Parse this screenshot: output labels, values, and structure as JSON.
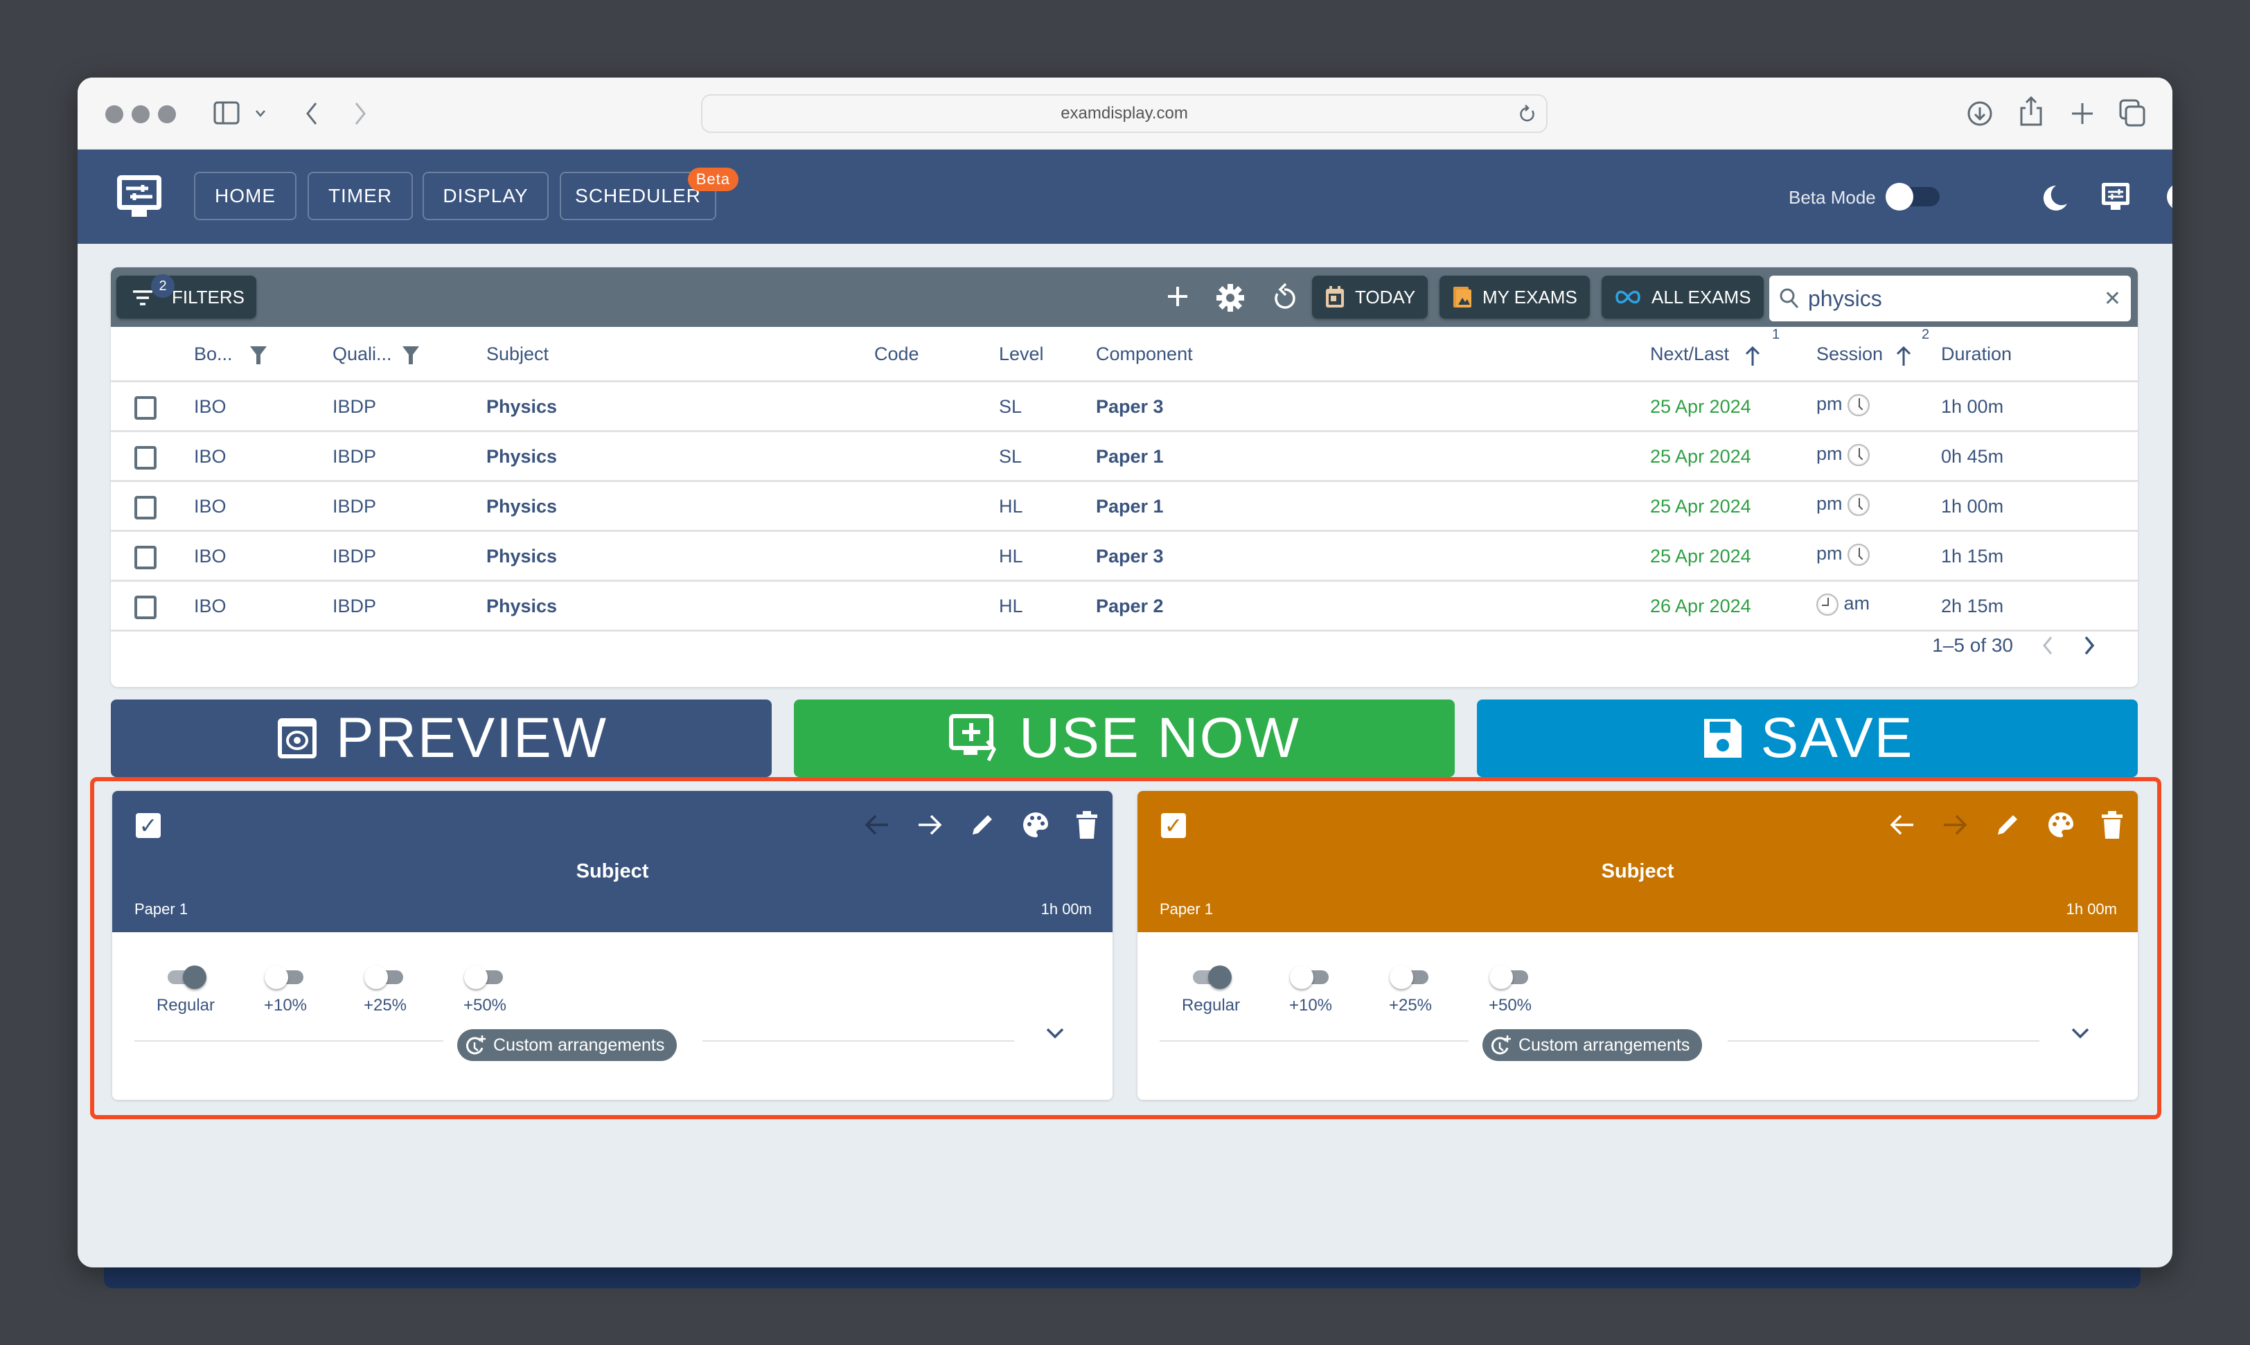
{
  "browser": {
    "url": "examdisplay.com"
  },
  "appbar": {
    "nav": [
      {
        "label": "HOME"
      },
      {
        "label": "TIMER"
      },
      {
        "label": "DISPLAY"
      },
      {
        "label": "SCHEDULER",
        "badge": "Beta"
      }
    ],
    "beta_mode_label": "Beta Mode",
    "beta_mode_on": false
  },
  "toolbar": {
    "filters_label": "FILTERS",
    "filters_count": "2",
    "today_label": "TODAY",
    "my_exams_label": "MY EXAMS",
    "all_exams_label": "ALL EXAMS",
    "search_value": "physics",
    "clear_label": "✕"
  },
  "table": {
    "columns": [
      "Bo...",
      "Quali...",
      "Subject",
      "Code",
      "Level",
      "Component",
      "Next/Last",
      "Session",
      "Duration"
    ],
    "sort_badges": {
      "next_last": "1",
      "session": "2"
    },
    "rows": [
      {
        "board": "IBO",
        "qualification": "IBDP",
        "subject": "Physics",
        "code": "",
        "level": "SL",
        "component": "Paper 3",
        "date": "25 Apr 2024",
        "session": "pm",
        "duration": "1h 00m"
      },
      {
        "board": "IBO",
        "qualification": "IBDP",
        "subject": "Physics",
        "code": "",
        "level": "SL",
        "component": "Paper 1",
        "date": "25 Apr 2024",
        "session": "pm",
        "duration": "0h 45m"
      },
      {
        "board": "IBO",
        "qualification": "IBDP",
        "subject": "Physics",
        "code": "",
        "level": "HL",
        "component": "Paper 1",
        "date": "25 Apr 2024",
        "session": "pm",
        "duration": "1h 00m"
      },
      {
        "board": "IBO",
        "qualification": "IBDP",
        "subject": "Physics",
        "code": "",
        "level": "HL",
        "component": "Paper 3",
        "date": "25 Apr 2024",
        "session": "pm",
        "duration": "1h 15m"
      },
      {
        "board": "IBO",
        "qualification": "IBDP",
        "subject": "Physics",
        "code": "",
        "level": "HL",
        "component": "Paper 2",
        "date": "26 Apr 2024",
        "session": "am",
        "duration": "2h 15m"
      }
    ],
    "pagination": "1–5 of 30"
  },
  "actions": {
    "preview_label": "PREVIEW",
    "use_now_label": "USE NOW",
    "save_label": "SAVE",
    "colors": {
      "preview": "#3a547e",
      "use_now": "#2fae4c",
      "save": "#0090cc"
    }
  },
  "cards": [
    {
      "title": "Subject",
      "component": "Paper 1",
      "duration": "1h 00m",
      "color": "#3a547e",
      "checked": true,
      "extra_time": [
        {
          "label": "Regular",
          "on": true
        },
        {
          "label": "+10%",
          "on": false
        },
        {
          "label": "+25%",
          "on": false
        },
        {
          "label": "+50%",
          "on": false
        }
      ],
      "custom_label": "Custom arrangements"
    },
    {
      "title": "Subject",
      "component": "Paper 1",
      "duration": "1h 00m",
      "color": "#c87400",
      "checked": true,
      "extra_time": [
        {
          "label": "Regular",
          "on": true
        },
        {
          "label": "+10%",
          "on": false
        },
        {
          "label": "+25%",
          "on": false
        },
        {
          "label": "+50%",
          "on": false
        }
      ],
      "custom_label": "Custom arrangements"
    }
  ]
}
